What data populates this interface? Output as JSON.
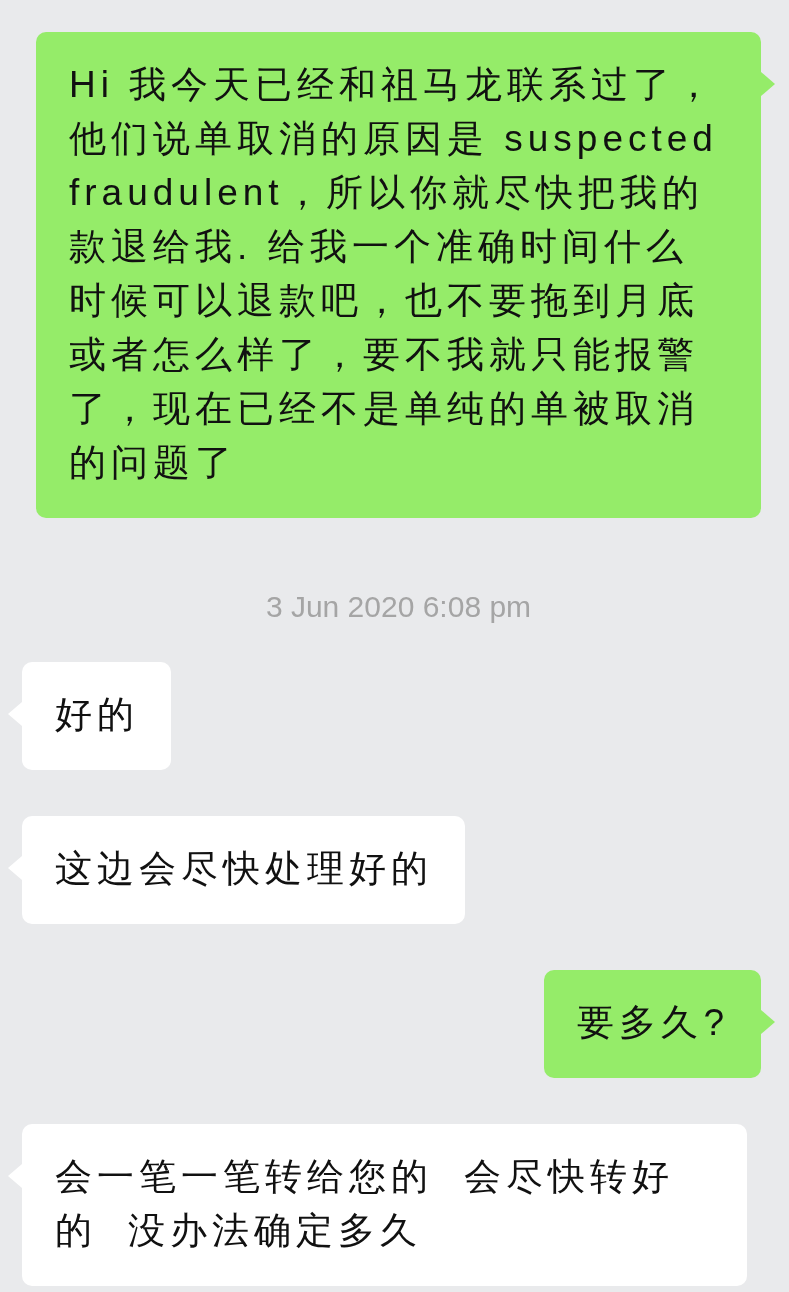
{
  "messages": [
    {
      "kind": "message",
      "outgoing": true,
      "text": "Hi 我今天已经和祖马龙联系过了，他们说单取消的原因是 suspected fraudulent，所以你就尽快把我的款退给我. 给我一个准确时间什么时候可以退款吧，也不要拖到月底或者怎么样了，要不我就只能报警了，现在已经不是单纯的单被取消的问题了"
    },
    {
      "kind": "time",
      "text": "3 Jun 2020 6:08 pm"
    },
    {
      "kind": "message",
      "outgoing": false,
      "text": "好的"
    },
    {
      "kind": "message",
      "outgoing": false,
      "text": "这边会尽快处理好的"
    },
    {
      "kind": "message",
      "outgoing": true,
      "text": "要多久?"
    },
    {
      "kind": "message",
      "outgoing": false,
      "text": "会一笔一笔转给您的  会尽快转好的  没办法确定多久"
    }
  ]
}
